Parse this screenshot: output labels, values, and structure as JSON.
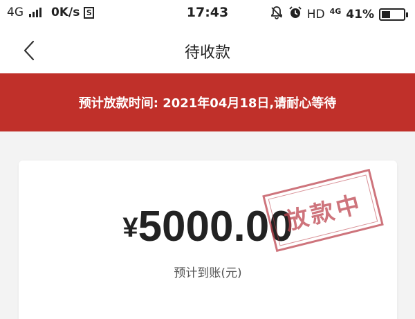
{
  "status_bar": {
    "network": "4G",
    "speed": "0K/s",
    "s_badge": "S",
    "time": "17:43",
    "hd": "HD",
    "net2": "4G",
    "battery_percent": "41%",
    "battery_level": 0.41
  },
  "nav": {
    "title": "待收款"
  },
  "banner": {
    "text": "预计放款时间: 2021年04月18日,请耐心等待"
  },
  "card": {
    "currency": "¥",
    "amount": "5000.00",
    "amount_label": "预计到账(元)",
    "stamp_text": "放款中"
  },
  "colors": {
    "banner": "#c0302a",
    "stamp": "#be4650",
    "background": "#f3f3f3"
  }
}
